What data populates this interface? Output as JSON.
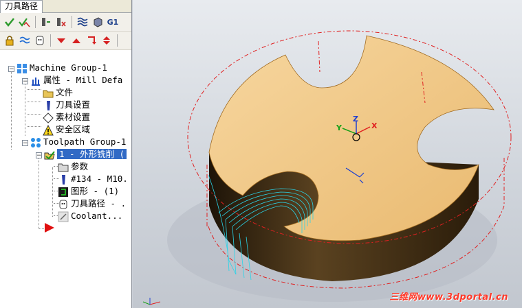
{
  "panel": {
    "tab_label": "刀具路径"
  },
  "toolbar": {
    "row1": [
      "verify-selected-icon",
      "verify-all-icon",
      "tool-regen-icon",
      "tool-delete-icon",
      "waves-icon",
      "stock-icon",
      "g1-icon"
    ],
    "row2": [
      "lock-icon",
      "toolpath-waves-icon",
      "ghost-icon",
      "arrow-down-icon",
      "arrow-up-icon",
      "jump-icon",
      "up-down-icon"
    ],
    "g1_label": "G1"
  },
  "tree": {
    "machine_group": "Machine Group-1",
    "properties": "属性 - Mill Defa",
    "files": "文件",
    "tool_settings": "刀具设置",
    "stock_setup": "素材设置",
    "safety_zone": "安全区域",
    "toolpath_group": "Toolpath Group-1",
    "operation": "1 - 外形铣削 (",
    "parameters": "参数",
    "tool": "#134 - M10.",
    "geometry": "图形 - (1)",
    "toolpath": "刀具路径 - .",
    "coolant": "Coolant..."
  },
  "viewport": {
    "axis_x": "X",
    "axis_y": "Y",
    "axis_z": "Z",
    "watermark": "三维网www.3dportal.cn"
  },
  "colors": {
    "part_top": "#f2c583",
    "part_side": "#3a2a12",
    "toolpath": "#2ad4e8",
    "stock_outline": "#e02020",
    "selection": "#316ac5"
  }
}
